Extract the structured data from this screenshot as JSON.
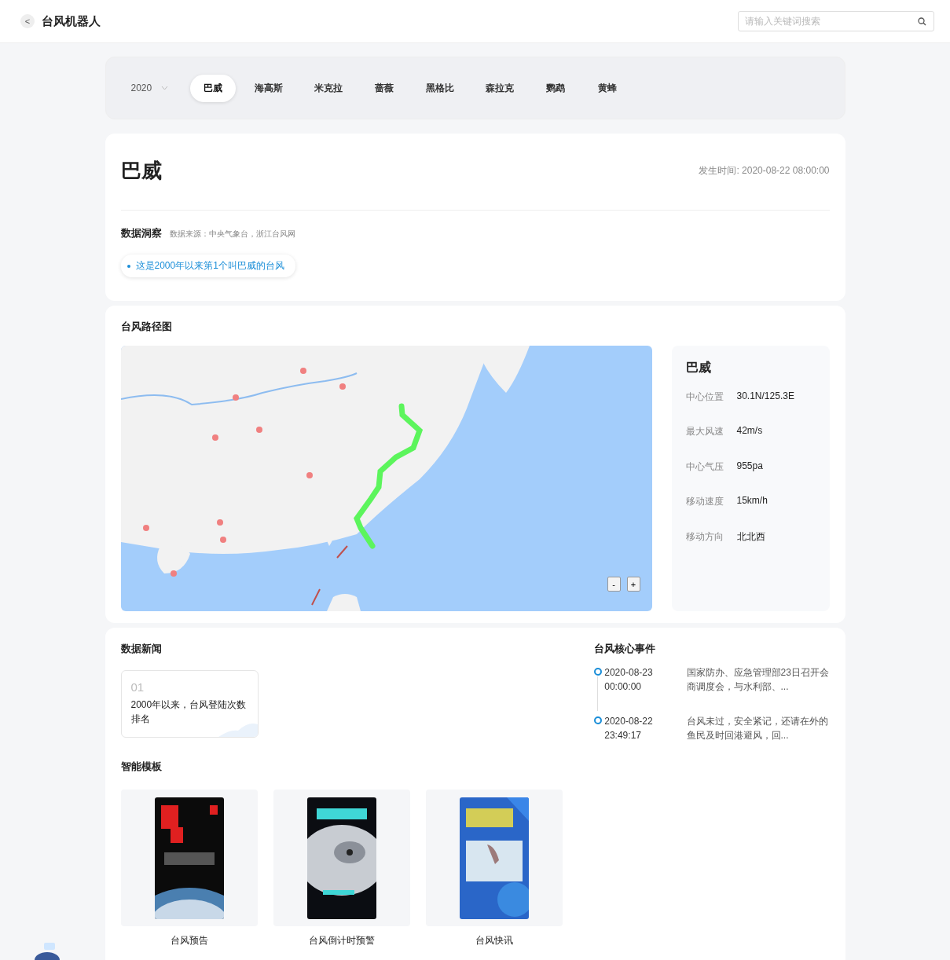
{
  "header": {
    "back": "<",
    "title": "台风机器人",
    "search": {
      "placeholder": "请输入关键词搜索"
    }
  },
  "filter": {
    "year": "2020",
    "typhoons": [
      {
        "label": "巴威",
        "selected": true
      },
      {
        "label": "海高斯",
        "selected": false
      },
      {
        "label": "米克拉",
        "selected": false
      },
      {
        "label": "蔷薇",
        "selected": false
      },
      {
        "label": "黑格比",
        "selected": false
      },
      {
        "label": "森拉克",
        "selected": false
      },
      {
        "label": "鹦鹉",
        "selected": false
      },
      {
        "label": "黄蜂",
        "selected": false
      }
    ]
  },
  "overview": {
    "name": "巴威",
    "time": "发生时间: 2020-08-22 08:00:00",
    "insight_title": "数据洞察",
    "source": "数据来源：中央气象台，浙江台风网",
    "insights": [
      "这是2000年以来第1个叫巴威的台风"
    ]
  },
  "track": {
    "title": "台风路径图",
    "map": {
      "kind": "picture",
      "zoom_out": "-",
      "zoom_in": "+"
    },
    "panel": {
      "name": "巴威",
      "fields": [
        {
          "label": "中心位置",
          "value": "30.1N/125.3E"
        },
        {
          "label": "最大风速",
          "value": "42m/s"
        },
        {
          "label": "中心气压",
          "value": "955pa"
        },
        {
          "label": "移动速度",
          "value": "15km/h"
        },
        {
          "label": "移动方向",
          "value": "北北西"
        }
      ]
    }
  },
  "news": {
    "title": "数据新闻",
    "items": [
      {
        "index": "01",
        "text": "2000年以来，台风登陆次数排名"
      }
    ]
  },
  "events": {
    "title": "台风核心事件",
    "items": [
      {
        "date": "2020-08-23",
        "time": "00:00:00",
        "text": "国家防办、应急管理部23日召开会商调度会，与水利部、..."
      },
      {
        "date": "2020-08-22",
        "time": "23:49:17",
        "text": "台风未过，安全紧记，还请在外的鱼民及时回港避风，回..."
      }
    ]
  },
  "templates": {
    "title": "智能模板",
    "items": [
      {
        "label": "台风预告",
        "kind": "dark"
      },
      {
        "label": "台风倒计时预警",
        "kind": "storm"
      },
      {
        "label": "台风快讯",
        "kind": "blue"
      }
    ]
  }
}
